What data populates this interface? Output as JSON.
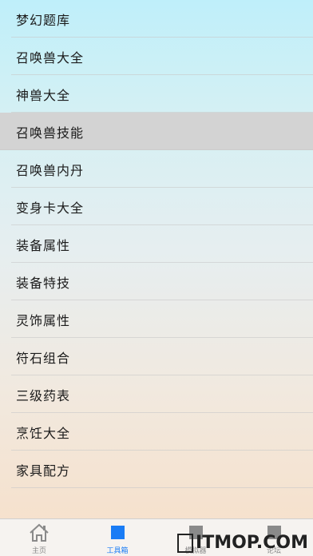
{
  "menu": {
    "items": [
      {
        "label": "梦幻题库",
        "selected": false
      },
      {
        "label": "召唤兽大全",
        "selected": false
      },
      {
        "label": "神兽大全",
        "selected": false
      },
      {
        "label": "召唤兽技能",
        "selected": true
      },
      {
        "label": "召唤兽内丹",
        "selected": false
      },
      {
        "label": "变身卡大全",
        "selected": false
      },
      {
        "label": "装备属性",
        "selected": false
      },
      {
        "label": "装备特技",
        "selected": false
      },
      {
        "label": "灵饰属性",
        "selected": false
      },
      {
        "label": "符石组合",
        "selected": false
      },
      {
        "label": "三级药表",
        "selected": false
      },
      {
        "label": "烹饪大全",
        "selected": false
      },
      {
        "label": "家具配方",
        "selected": false
      }
    ]
  },
  "tabbar": {
    "tabs": [
      {
        "label": "主页",
        "icon": "home-icon",
        "active": false
      },
      {
        "label": "工具箱",
        "icon": "toolbox-icon",
        "active": true
      },
      {
        "label": "模拟器",
        "icon": "simulator-icon",
        "active": false
      },
      {
        "label": "论坛",
        "icon": "forum-icon",
        "active": false
      }
    ]
  },
  "watermark": {
    "text": "ITMOP.COM"
  },
  "colors": {
    "accent": "#1a7cf5",
    "selected_row": "#d3d3d3",
    "inactive_icon": "#8a8a8a"
  }
}
